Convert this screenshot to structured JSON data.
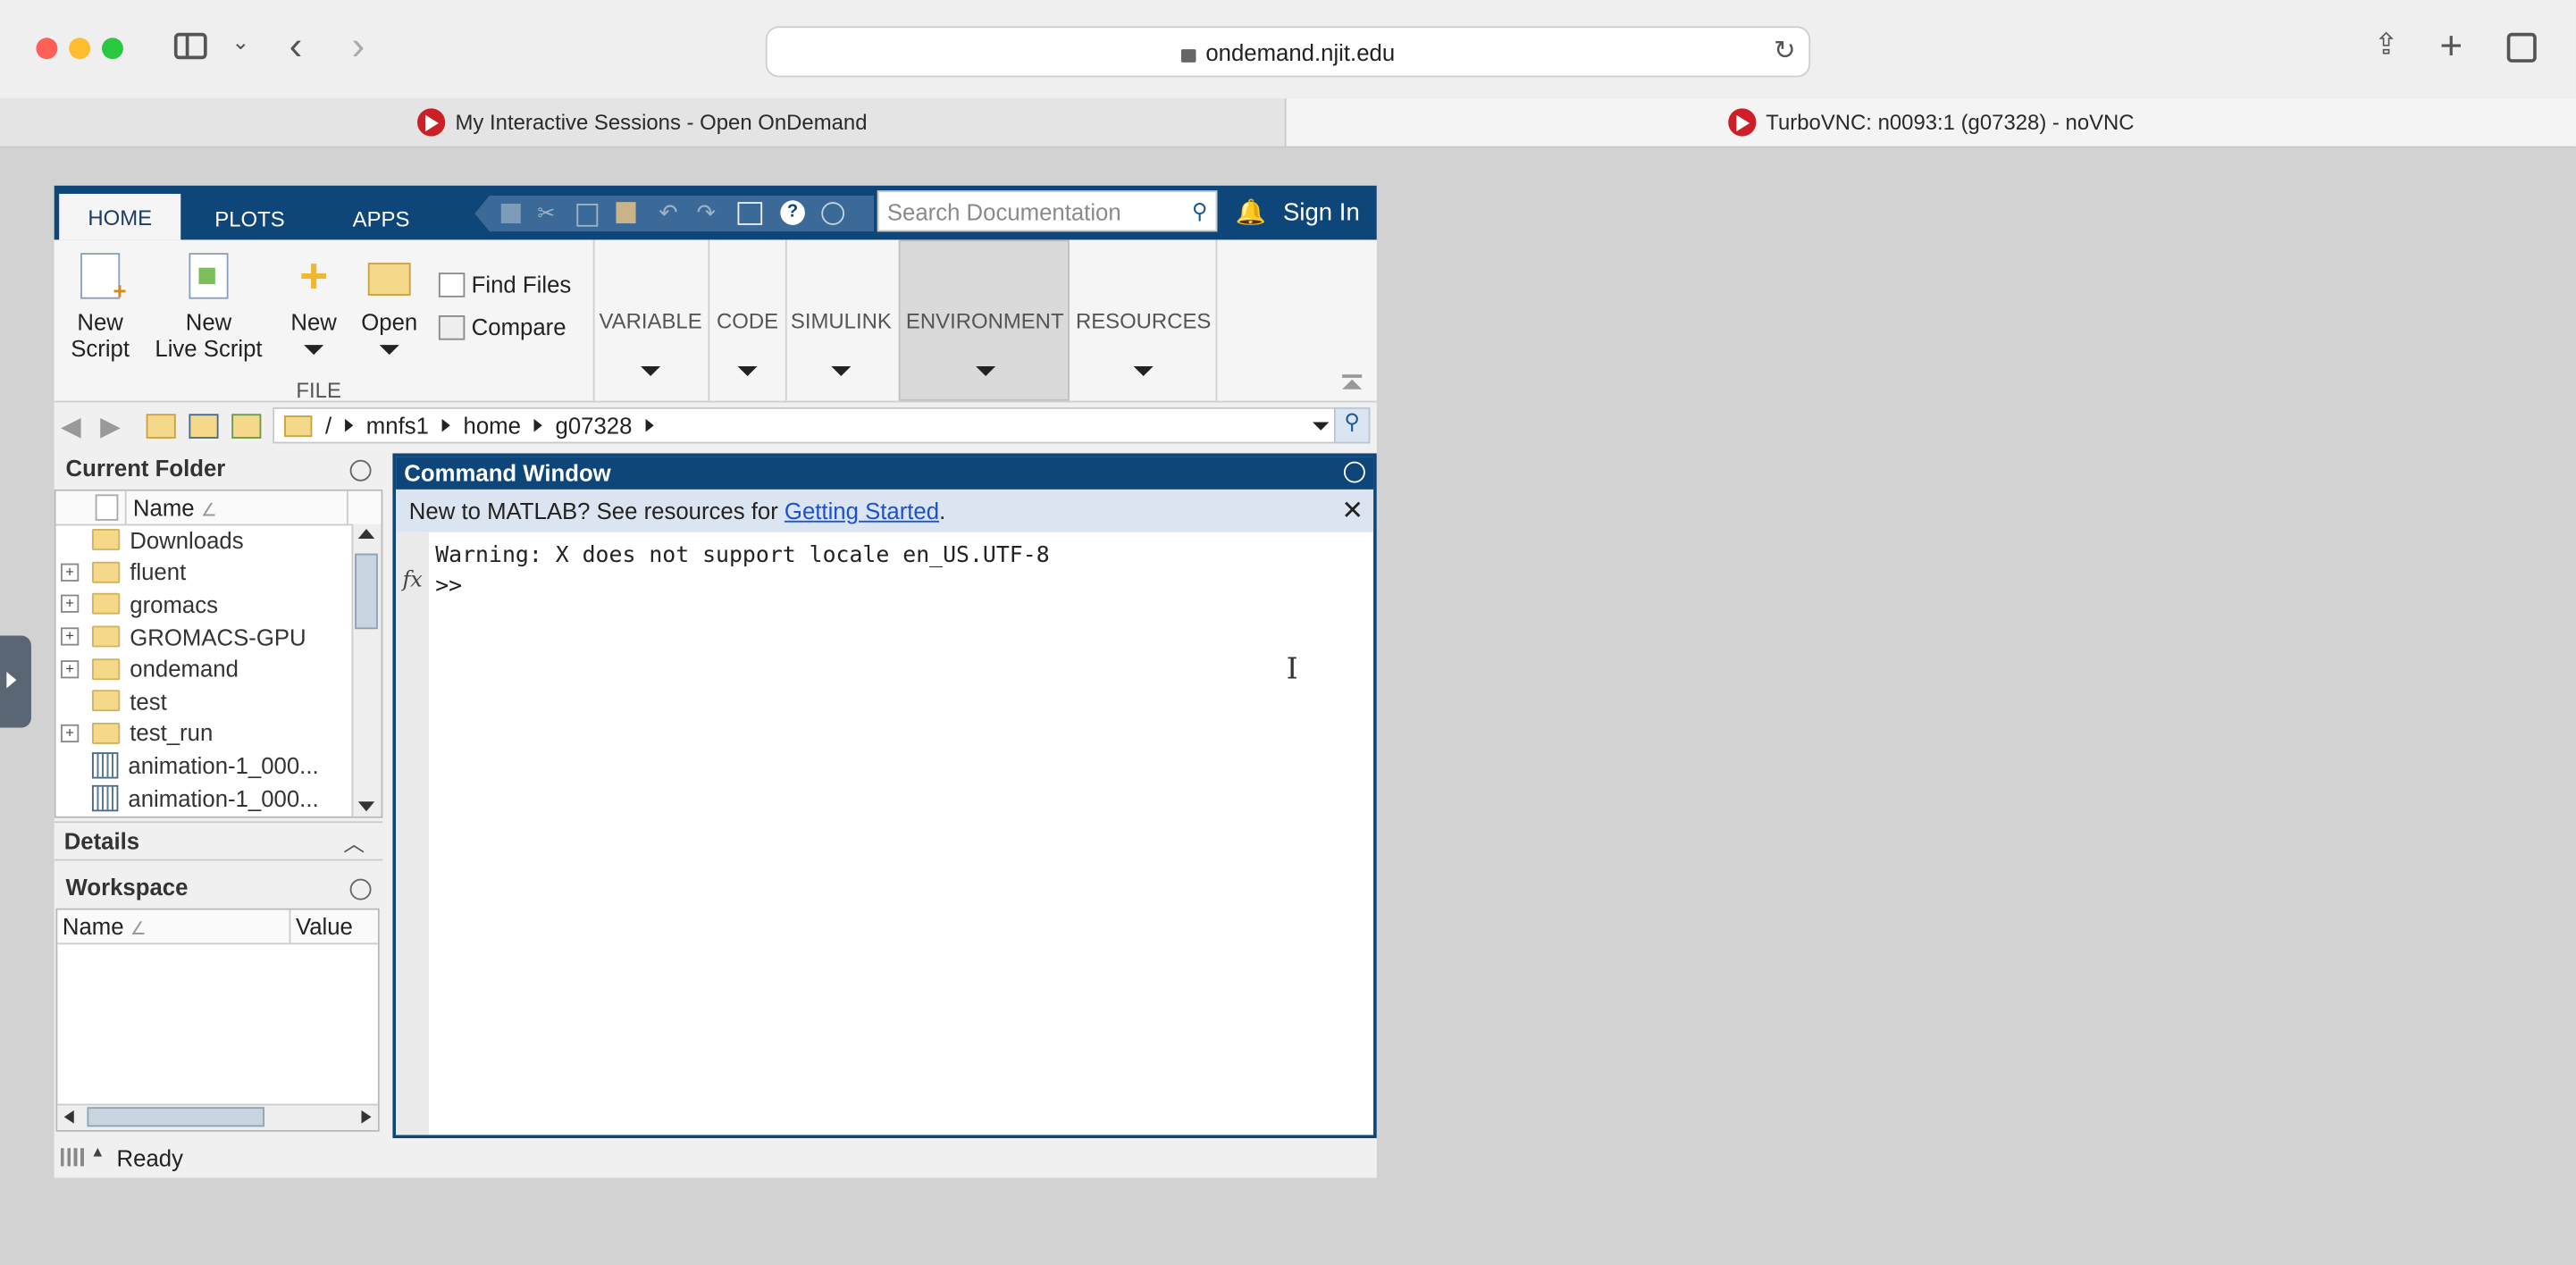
{
  "browser": {
    "url": "ondemand.njit.edu",
    "tabs": [
      {
        "label": "My Interactive Sessions - Open OnDemand"
      },
      {
        "label": "TurboVNC: n0093:1 (g07328) - noVNC"
      }
    ]
  },
  "matlab": {
    "ribbon_tabs": [
      "HOME",
      "PLOTS",
      "APPS"
    ],
    "search_placeholder": "Search Documentation",
    "sign_in": "Sign In",
    "file": {
      "new_script": "New\nScript",
      "new_live_script": "New\nLive Script",
      "new": "New",
      "open": "Open",
      "find_files": "Find Files",
      "compare": "Compare",
      "group_label": "FILE"
    },
    "groups": [
      "VARIABLE",
      "CODE",
      "SIMULINK",
      "ENVIRONMENT",
      "RESOURCES"
    ],
    "path": [
      "/",
      "mnfs1",
      "home",
      "g07328"
    ],
    "current_folder": {
      "title": "Current Folder",
      "col_name": "Name",
      "items": [
        {
          "name": "Downloads",
          "type": "folder",
          "expandable": false
        },
        {
          "name": "fluent",
          "type": "folder",
          "expandable": true
        },
        {
          "name": "gromacs",
          "type": "folder",
          "expandable": true
        },
        {
          "name": "GROMACS-GPU",
          "type": "folder",
          "expandable": true
        },
        {
          "name": "ondemand",
          "type": "folder",
          "expandable": true
        },
        {
          "name": "test",
          "type": "folder",
          "expandable": false
        },
        {
          "name": "test_run",
          "type": "folder",
          "expandable": true
        },
        {
          "name": "animation-1_000...",
          "type": "file",
          "expandable": false
        },
        {
          "name": "animation-1_000...",
          "type": "file",
          "expandable": false
        }
      ]
    },
    "details_title": "Details",
    "workspace": {
      "title": "Workspace",
      "col_name": "Name",
      "col_value": "Value"
    },
    "command_window": {
      "title": "Command Window",
      "banner_prefix": "New to MATLAB? See resources for ",
      "banner_link": "Getting Started",
      "banner_suffix": ".",
      "warning": "Warning: X does not support locale en_US.UTF-8",
      "prompt": ">>",
      "fx": "fx"
    },
    "status": "Ready"
  }
}
